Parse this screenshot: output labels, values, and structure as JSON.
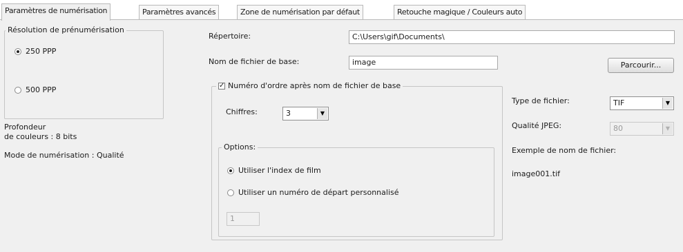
{
  "tabs": [
    {
      "label": "Paramètres de numérisation",
      "active": true
    },
    {
      "label": "Paramètres avancés",
      "active": false
    },
    {
      "label": "Zone de numérisation par défaut",
      "active": false
    },
    {
      "label": "Retouche magique / Couleurs auto",
      "active": false
    }
  ],
  "prescan": {
    "legend": "Résolution de prénumérisation",
    "options": [
      "250 PPP",
      "500 PPP"
    ],
    "selected": "250 PPP"
  },
  "info": {
    "depth_line1": "Profondeur",
    "depth_line2": "de couleurs : 8 bits",
    "mode": "Mode de numérisation : Qualité"
  },
  "directory": {
    "label": "Répertoire:",
    "value": "C:\\Users\\gif\\Documents\\"
  },
  "basename": {
    "label": "Nom de fichier de base:",
    "value": "image"
  },
  "browse_label": "Parcourir...",
  "sequence": {
    "checkbox_label": "Numéro d'ordre après nom de fichier de base",
    "checked": true,
    "digits_label": "Chiffres:",
    "digits_value": "3"
  },
  "options": {
    "legend": "Options:",
    "radio_film_index": "Utiliser l'index de film",
    "radio_custom_start": "Utiliser un numéro de départ personnalisé",
    "selected": "film_index",
    "custom_start_value": "1"
  },
  "file_type": {
    "label": "Type de fichier:",
    "value": "TIF"
  },
  "jpeg_quality": {
    "label": "Qualité JPEG:",
    "value": "80",
    "disabled": true
  },
  "example": {
    "label": "Exemple de nom de fichier:",
    "value": "image001.tif"
  }
}
